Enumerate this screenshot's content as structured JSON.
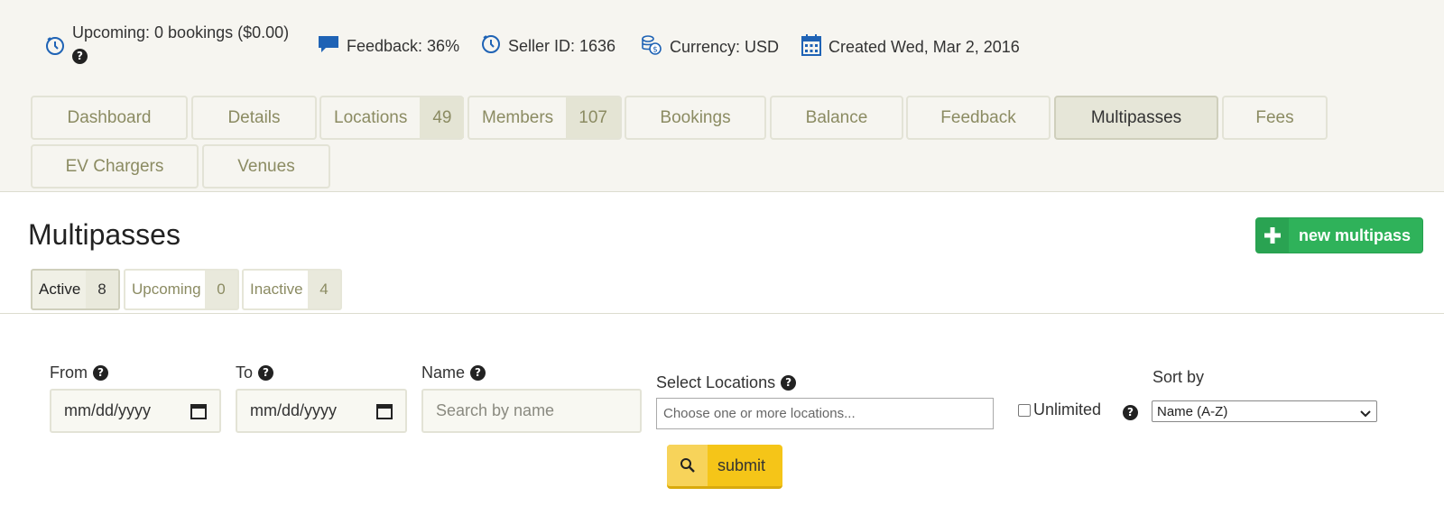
{
  "header": {
    "upcoming": "Upcoming: 0 bookings ($0.00)",
    "feedback": "Feedback: 36%",
    "seller_id": "Seller ID: 1636",
    "currency": "Currency: USD",
    "created": "Created Wed, Mar 2, 2016",
    "help_glyph": "?"
  },
  "nav_tabs": [
    {
      "label": "Dashboard"
    },
    {
      "label": "Details"
    },
    {
      "label": "Locations",
      "count": "49"
    },
    {
      "label": "Members",
      "count": "107"
    },
    {
      "label": "Bookings"
    },
    {
      "label": "Balance"
    },
    {
      "label": "Feedback"
    },
    {
      "label": "Multipasses",
      "active": true
    },
    {
      "label": "Fees"
    },
    {
      "label": "EV Chargers"
    },
    {
      "label": "Venues"
    }
  ],
  "page": {
    "title": "Multipasses",
    "new_button": "new multipass",
    "new_button_icon": "plus-icon"
  },
  "sub_tabs": [
    {
      "label": "Active",
      "count": "8",
      "active": true
    },
    {
      "label": "Upcoming",
      "count": "0"
    },
    {
      "label": "Inactive",
      "count": "4"
    }
  ],
  "filters": {
    "from_label": "From",
    "from_value": "mm/dd/yyyy",
    "to_label": "To",
    "to_value": "mm/dd/yyyy",
    "name_label": "Name",
    "name_placeholder": "Search by name",
    "locations_label": "Select Locations",
    "locations_placeholder": "Choose one or more locations...",
    "unlimited_label": "Unlimited",
    "sort_label": "Sort by",
    "sort_value": "Name (A-Z)",
    "submit_label": "submit"
  },
  "colors": {
    "accent_green": "#2fb25a",
    "submit_yellow": "#f5c518",
    "icon_blue": "#1f63b5",
    "tab_text": "#8b8b62"
  }
}
